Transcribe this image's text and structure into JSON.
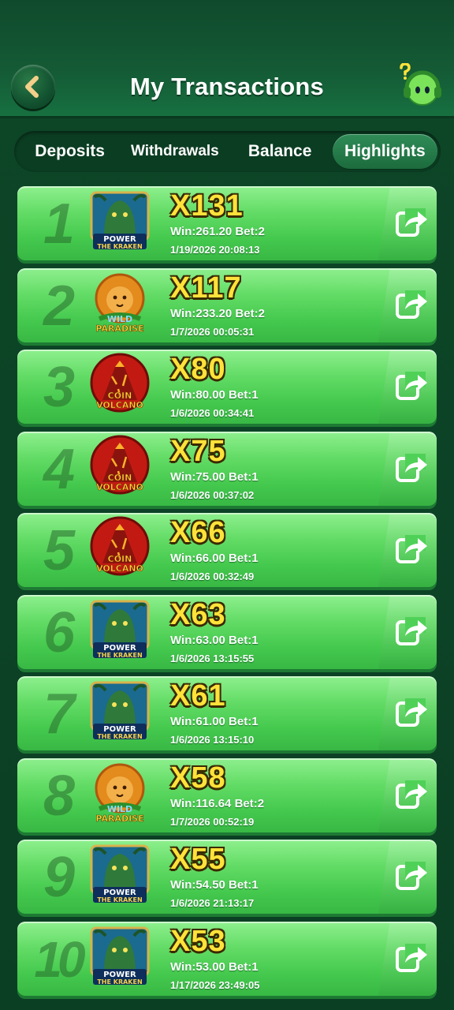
{
  "header": {
    "title": "My Transactions",
    "back_icon": "chevron-left-icon",
    "support_icon": "support-headset-icon"
  },
  "tabs": [
    {
      "label": "Deposits",
      "active": false
    },
    {
      "label": "Withdrawals",
      "active": false
    },
    {
      "label": "Balance",
      "active": false
    },
    {
      "label": "Highlights",
      "active": true
    }
  ],
  "colors": {
    "accent_yellow": "#ffe23a",
    "row_green": "#63dc66",
    "background": "#0b3f24"
  },
  "highlights": [
    {
      "rank": "1",
      "game": "Power of the Kraken",
      "multiplier": "X131",
      "win_bet": "Win:261.20 Bet:2",
      "date": "1/19/2026 20:08:13"
    },
    {
      "rank": "2",
      "game": "Wild Paradise",
      "multiplier": "X117",
      "win_bet": "Win:233.20 Bet:2",
      "date": "1/7/2026 00:05:31"
    },
    {
      "rank": "3",
      "game": "Coin Volcano",
      "multiplier": "X80",
      "win_bet": "Win:80.00 Bet:1",
      "date": "1/6/2026 00:34:41"
    },
    {
      "rank": "4",
      "game": "Coin Volcano",
      "multiplier": "X75",
      "win_bet": "Win:75.00 Bet:1",
      "date": "1/6/2026 00:37:02"
    },
    {
      "rank": "5",
      "game": "Coin Volcano",
      "multiplier": "X66",
      "win_bet": "Win:66.00 Bet:1",
      "date": "1/6/2026 00:32:49"
    },
    {
      "rank": "6",
      "game": "Power of the Kraken",
      "multiplier": "X63",
      "win_bet": "Win:63.00 Bet:1",
      "date": "1/6/2026 13:15:55"
    },
    {
      "rank": "7",
      "game": "Power of the Kraken",
      "multiplier": "X61",
      "win_bet": "Win:61.00 Bet:1",
      "date": "1/6/2026 13:15:10"
    },
    {
      "rank": "8",
      "game": "Wild Paradise",
      "multiplier": "X58",
      "win_bet": "Win:116.64 Bet:2",
      "date": "1/7/2026 00:52:19"
    },
    {
      "rank": "9",
      "game": "Power of the Kraken",
      "multiplier": "X55",
      "win_bet": "Win:54.50 Bet:1",
      "date": "1/6/2026 21:13:17"
    },
    {
      "rank": "10",
      "game": "Power of the Kraken",
      "multiplier": "X53",
      "win_bet": "Win:53.00 Bet:1",
      "date": "1/17/2026 23:49:05"
    }
  ]
}
